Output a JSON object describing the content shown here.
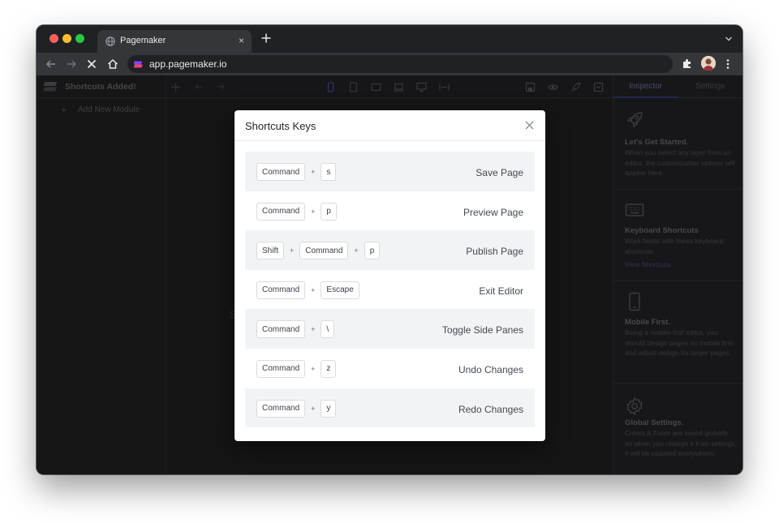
{
  "browser": {
    "tab_title": "Pagemaker",
    "tab_close": "×",
    "url": "app.pagemaker.io"
  },
  "app": {
    "brand_title": "Shortcuts Added!",
    "add_module_label": "Add New Module",
    "add_module_icon": "+",
    "canvas_peek_text": "S",
    "inspector_tab": "Inspector",
    "settings_tab": "Settings",
    "cards": [
      {
        "icon": "rocket-icon",
        "title": "Let's Get Started.",
        "text": "When you select any layer from an editor, the customization options will appear here.",
        "link": ""
      },
      {
        "icon": "keyboard-icon",
        "title": "Keyboard Shortcuts",
        "text": "Work faster with these keyboard shortcuts.",
        "link": "View Shortcuts"
      },
      {
        "icon": "mobile-icon",
        "title": "Mobile First.",
        "text": "Being a mobile-first editor, you should design pages on mobile first and adjust design for larger pages.",
        "link": ""
      },
      {
        "icon": "gear-icon",
        "title": "Global Settings.",
        "text": "Colors & Fonts are saved globally so when you change it from settings, it will be updated everywhere.",
        "link": ""
      }
    ]
  },
  "modal": {
    "title": "Shortcuts Keys",
    "plus": "+",
    "shortcuts": [
      {
        "keys": [
          "Command",
          "s"
        ],
        "label": "Save Page"
      },
      {
        "keys": [
          "Command",
          "p"
        ],
        "label": "Preview Page"
      },
      {
        "keys": [
          "Shift",
          "Command",
          "p"
        ],
        "label": "Publish Page"
      },
      {
        "keys": [
          "Command",
          "Escape"
        ],
        "label": "Exit Editor"
      },
      {
        "keys": [
          "Command",
          "\\"
        ],
        "label": "Toggle Side Panes"
      },
      {
        "keys": [
          "Command",
          "z"
        ],
        "label": "Undo Changes"
      },
      {
        "keys": [
          "Command",
          "y"
        ],
        "label": "Redo Changes"
      }
    ]
  },
  "colors": {
    "traffic_red": "#fe5f57",
    "traffic_yellow": "#febc2e",
    "traffic_green": "#28c840",
    "brand_accent": "#8a3ffc"
  }
}
